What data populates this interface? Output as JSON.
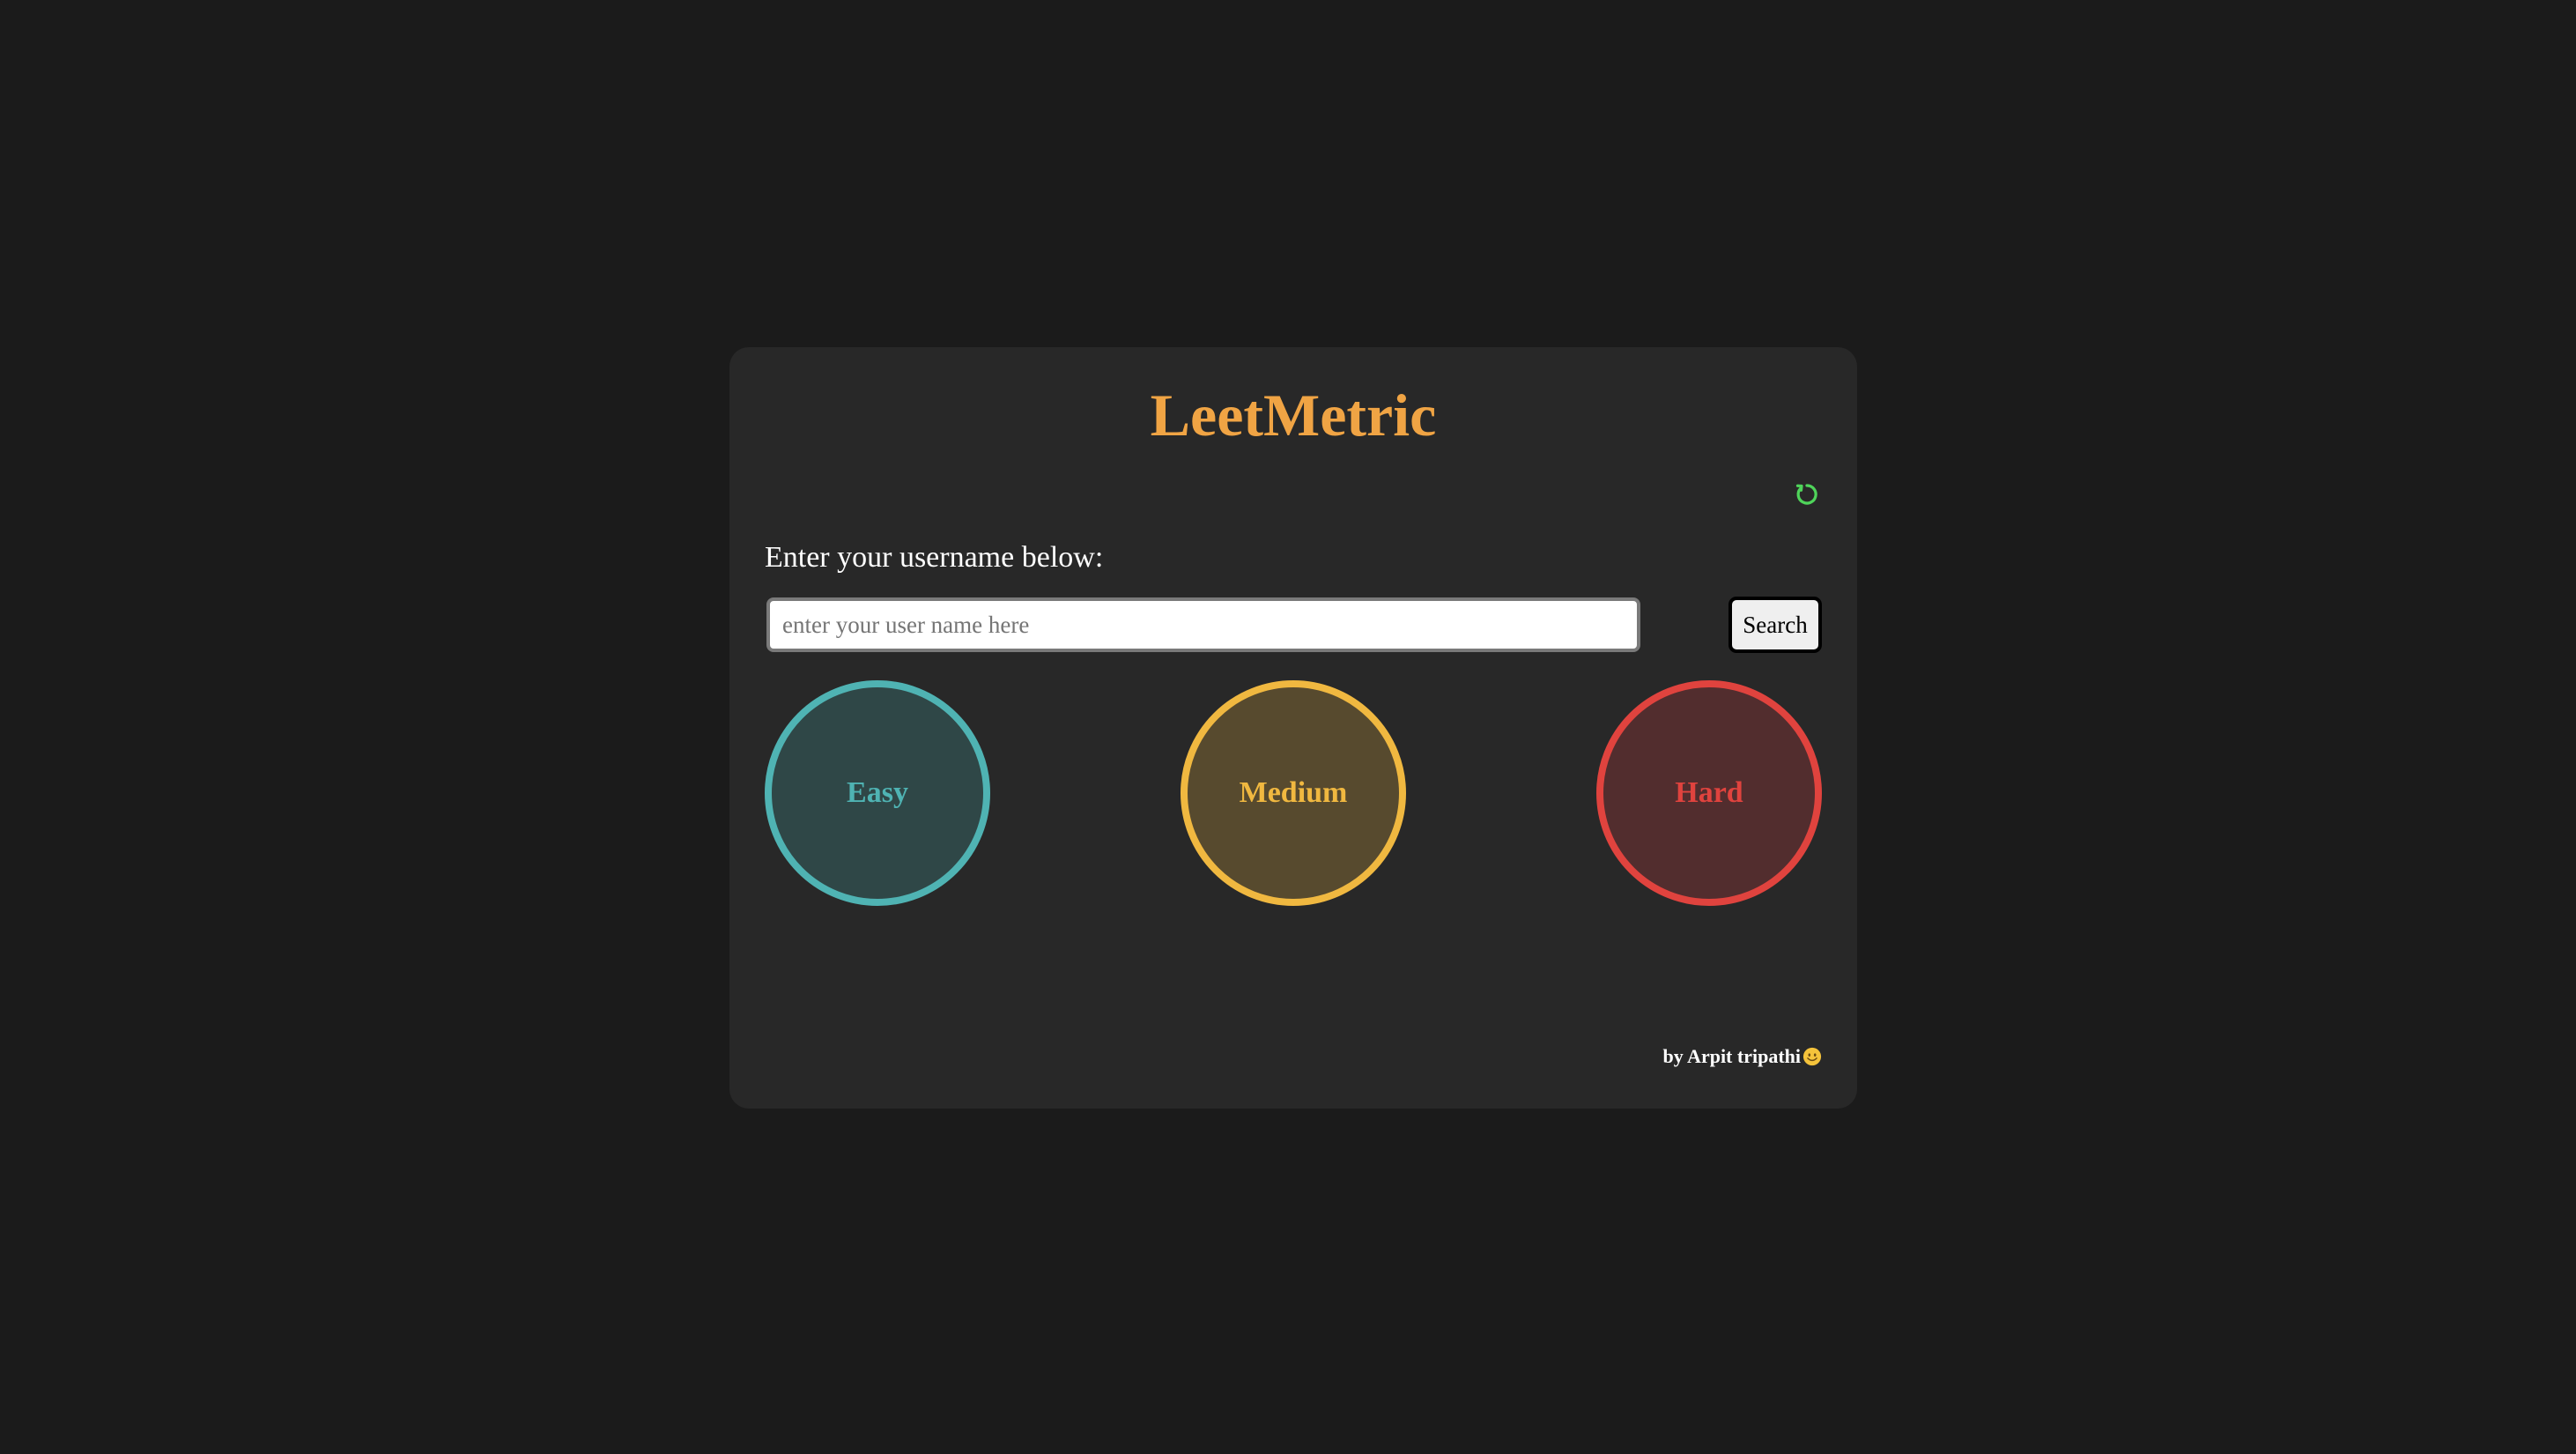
{
  "app": {
    "title": "LeetMetric"
  },
  "header": {
    "refresh_icon": "refresh-icon",
    "refresh_color": "#4fd45a"
  },
  "search": {
    "label": "Enter your username below:",
    "placeholder": "enter your user name here",
    "value": "",
    "button_label": "Search"
  },
  "progress": [
    {
      "label": "Easy",
      "color": "#4fb3b3",
      "fill": "#2f4747"
    },
    {
      "label": "Medium",
      "color": "#f0b840",
      "fill": "#574a2e"
    },
    {
      "label": "Hard",
      "color": "#e0433e",
      "fill": "#522d2e"
    }
  ],
  "footer": {
    "credit": "by Arpit tripathi",
    "emoji_icon": "smiley-emoji-icon"
  },
  "colors": {
    "page_bg": "#1b1b1b",
    "card_bg": "#282828",
    "title": "#f0a444"
  }
}
